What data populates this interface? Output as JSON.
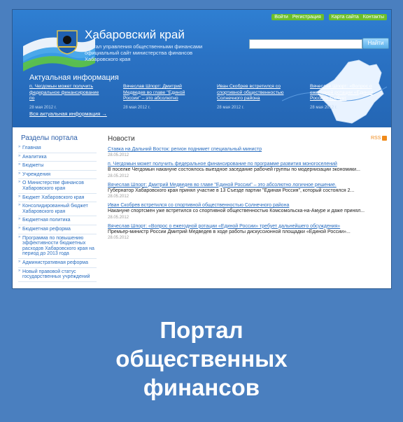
{
  "top_links": {
    "login": "Войти",
    "register": "Регистрация",
    "sitemap": "Карта сайта",
    "contacts": "Контакты"
  },
  "header": {
    "title": "Хабаровский край",
    "subtitle": "портал управления общественными финансами официальный сайт министерства финансов Хабаровского края",
    "search_button": "Найти"
  },
  "actual": {
    "title": "Актуальная информация",
    "all_link": "Вся актуальная информация →",
    "items": [
      {
        "title": "п. Чегдомын может получить федеральное финансирование по",
        "date": "28 мая 2012 г."
      },
      {
        "title": "Вячеслав Шпорт: Дмитрий Медведев во главе \"Единой России\" – это абсолютно",
        "date": "28 мая 2012 г."
      },
      {
        "title": "Иван Скобрев встретился со спортивной общественностью Солнечного района",
        "date": "28 мая 2012 г."
      },
      {
        "title": "Вячеслав Шпорт: «Вопрос о ежегодной ротации «Единой России» требует",
        "date": "28 мая 2012 г."
      }
    ]
  },
  "sidebar": {
    "title": "Разделы портала",
    "items": [
      "Главная",
      "Аналитика",
      "Бюджеты",
      "Учреждения",
      "О Министерстве финансов Хабаровского края",
      "Бюджет Хабаровского края",
      "Консолидированный бюджет Хабаровского края",
      "Бюджетная политика",
      "Бюджетная реформа",
      "Программа по повышению эффективности бюджетных расходов Хабаровского края на период до 2013 года",
      "Административная реформа",
      "Новый правовой статус государственных учреждений"
    ]
  },
  "news": {
    "title": "Новости",
    "rss": "RSS",
    "items": [
      {
        "title": "Ставка на Дальний Восток: регион поднимет специальный министр",
        "text": "",
        "date": "28.05.2012"
      },
      {
        "title": "п. Чегдомын может получить федеральное финансирование по программе развития моногоселений",
        "text": "В поселке Чегдомын накануне состоялось выездное заседание рабочей группы по модернизации экономики...",
        "date": "28.05.2012"
      },
      {
        "title": "Вячеслав Шпорт: Дмитрий Медведев во главе \"Единой России\" – это абсолютно логичное решение.",
        "text": "Губернатор Хабаровского края принял участие в 13 Съезде партии \"Единая Россия\", который состоялся 2...",
        "date": "28.05.2012"
      },
      {
        "title": "Иван Скобрев встретился со спортивной общественностью Солнечного района",
        "text": "Накануне спортсмен уже встретился со спортивной общественностью Комсомольска-на-Амуре и даже принял...",
        "date": "28.05.2012"
      },
      {
        "title": "Вячеслав Шпорт: «Вопрос о ежегодной ротации «Единой России» требует дальнейшего обсуждения»",
        "text": "Премьер-министр России Дмитрий Медведев в ходе работы дискуссионной площадки «Единой России»...",
        "date": "28.05.2012"
      }
    ]
  },
  "caption": {
    "line1": "Портал",
    "line2": "общественных",
    "line3": "финансов"
  }
}
